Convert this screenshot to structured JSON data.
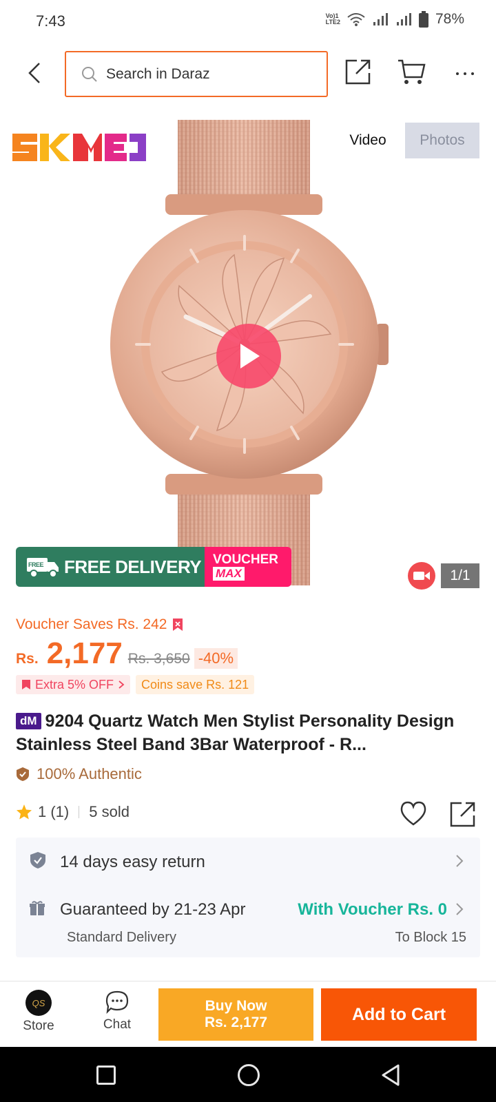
{
  "status_bar": {
    "time": "7:43",
    "volte": "Vo) 1\nLTE2",
    "battery": "78%"
  },
  "header": {
    "search_placeholder": "Search in Daraz",
    "icons": [
      "back-arrow-icon",
      "search-icon",
      "share-icon",
      "cart-icon",
      "more-icon"
    ]
  },
  "gallery": {
    "brand": "SKMEI",
    "tabs": [
      {
        "label": "Video",
        "active": true
      },
      {
        "label": "Photos",
        "active": false
      }
    ],
    "promo_free": "FREE DELIVERY",
    "promo_free_badge": "FREE",
    "promo_voucher_line1": "VOUCHER",
    "promo_voucher_line2": "MAX",
    "counter": "1/1",
    "colors": {
      "watch_gold": "#e7b39a",
      "play_pink": "#f7486a",
      "free_green": "#2f7d5f",
      "voucher_pink": "#ff1a6b"
    }
  },
  "pricing": {
    "voucher_saves": "Voucher Saves Rs. 242",
    "currency": "Rs.",
    "price": "2,177",
    "original_price": "Rs. 3,650",
    "discount": "-40%",
    "extra_off": "Extra 5% OFF",
    "coins": "Coins save Rs. 121",
    "accent_color": "#f36a26"
  },
  "product": {
    "badge": "dM",
    "title": "9204 Quartz Watch Men Stylist Personality Design Stainless Steel Band 3Bar Waterproof - R...",
    "authentic": "100% Authentic",
    "rating": "1 (1)",
    "sold": "5 sold"
  },
  "delivery": {
    "return_text": "14 days easy return",
    "guarantee_text": "Guaranteed by 21-23 Apr",
    "voucher_text": "With Voucher Rs. 0",
    "method": "Standard Delivery",
    "destination": "To Block 15",
    "voucher_color": "#17b59a"
  },
  "action_bar": {
    "store_label": "Store",
    "store_logo": "QS",
    "chat_label": "Chat",
    "buy_now_line1": "Buy Now",
    "buy_now_line2": "Rs. 2,177",
    "add_to_cart": "Add to Cart",
    "buy_color": "#f9a825",
    "cart_color": "#f85606"
  }
}
